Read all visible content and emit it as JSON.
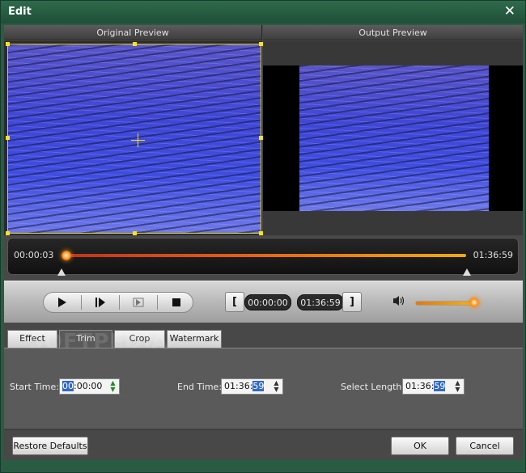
{
  "window": {
    "title": "Edit",
    "close_label": "✕"
  },
  "preview": {
    "original_title": "Original Preview",
    "output_title": "Output Preview"
  },
  "timeline": {
    "current_time": "00:00:03",
    "end_time": "01:36:59",
    "progress_fraction": 0.0
  },
  "controls": {
    "play_icon": "play-icon",
    "step_icon": "step-forward-icon",
    "frame_icon": "next-frame-icon",
    "stop_icon": "stop-icon",
    "start_bracket": "[",
    "start_time": "00:00:00",
    "end_time": "01:36:59",
    "end_bracket": "]",
    "volume_icon": "speaker-icon",
    "volume_level": 1.0
  },
  "tabs": [
    {
      "label": "Effect",
      "active": false
    },
    {
      "label": "Trim",
      "active": true
    },
    {
      "label": "Crop",
      "active": false
    },
    {
      "label": "Watermark",
      "active": false
    }
  ],
  "overlay_watermark": "SOFTPEDIA",
  "trim": {
    "start_label": "Start Time:",
    "start_value_sel": "00",
    "start_value_rest": ":00:00",
    "end_label": "End Time:",
    "end_value_rest": "01:36:",
    "end_value_sel": "59",
    "length_label": "Select Length:",
    "length_value_rest": "01:36:",
    "length_value_sel": "59"
  },
  "footer": {
    "restore_label": "Restore Defaults",
    "ok_label": "OK",
    "cancel_label": "Cancel"
  },
  "colors": {
    "frame_green": "#2a5c44",
    "accent_orange": "#f2a914",
    "selection_blue": "#3169c6"
  }
}
